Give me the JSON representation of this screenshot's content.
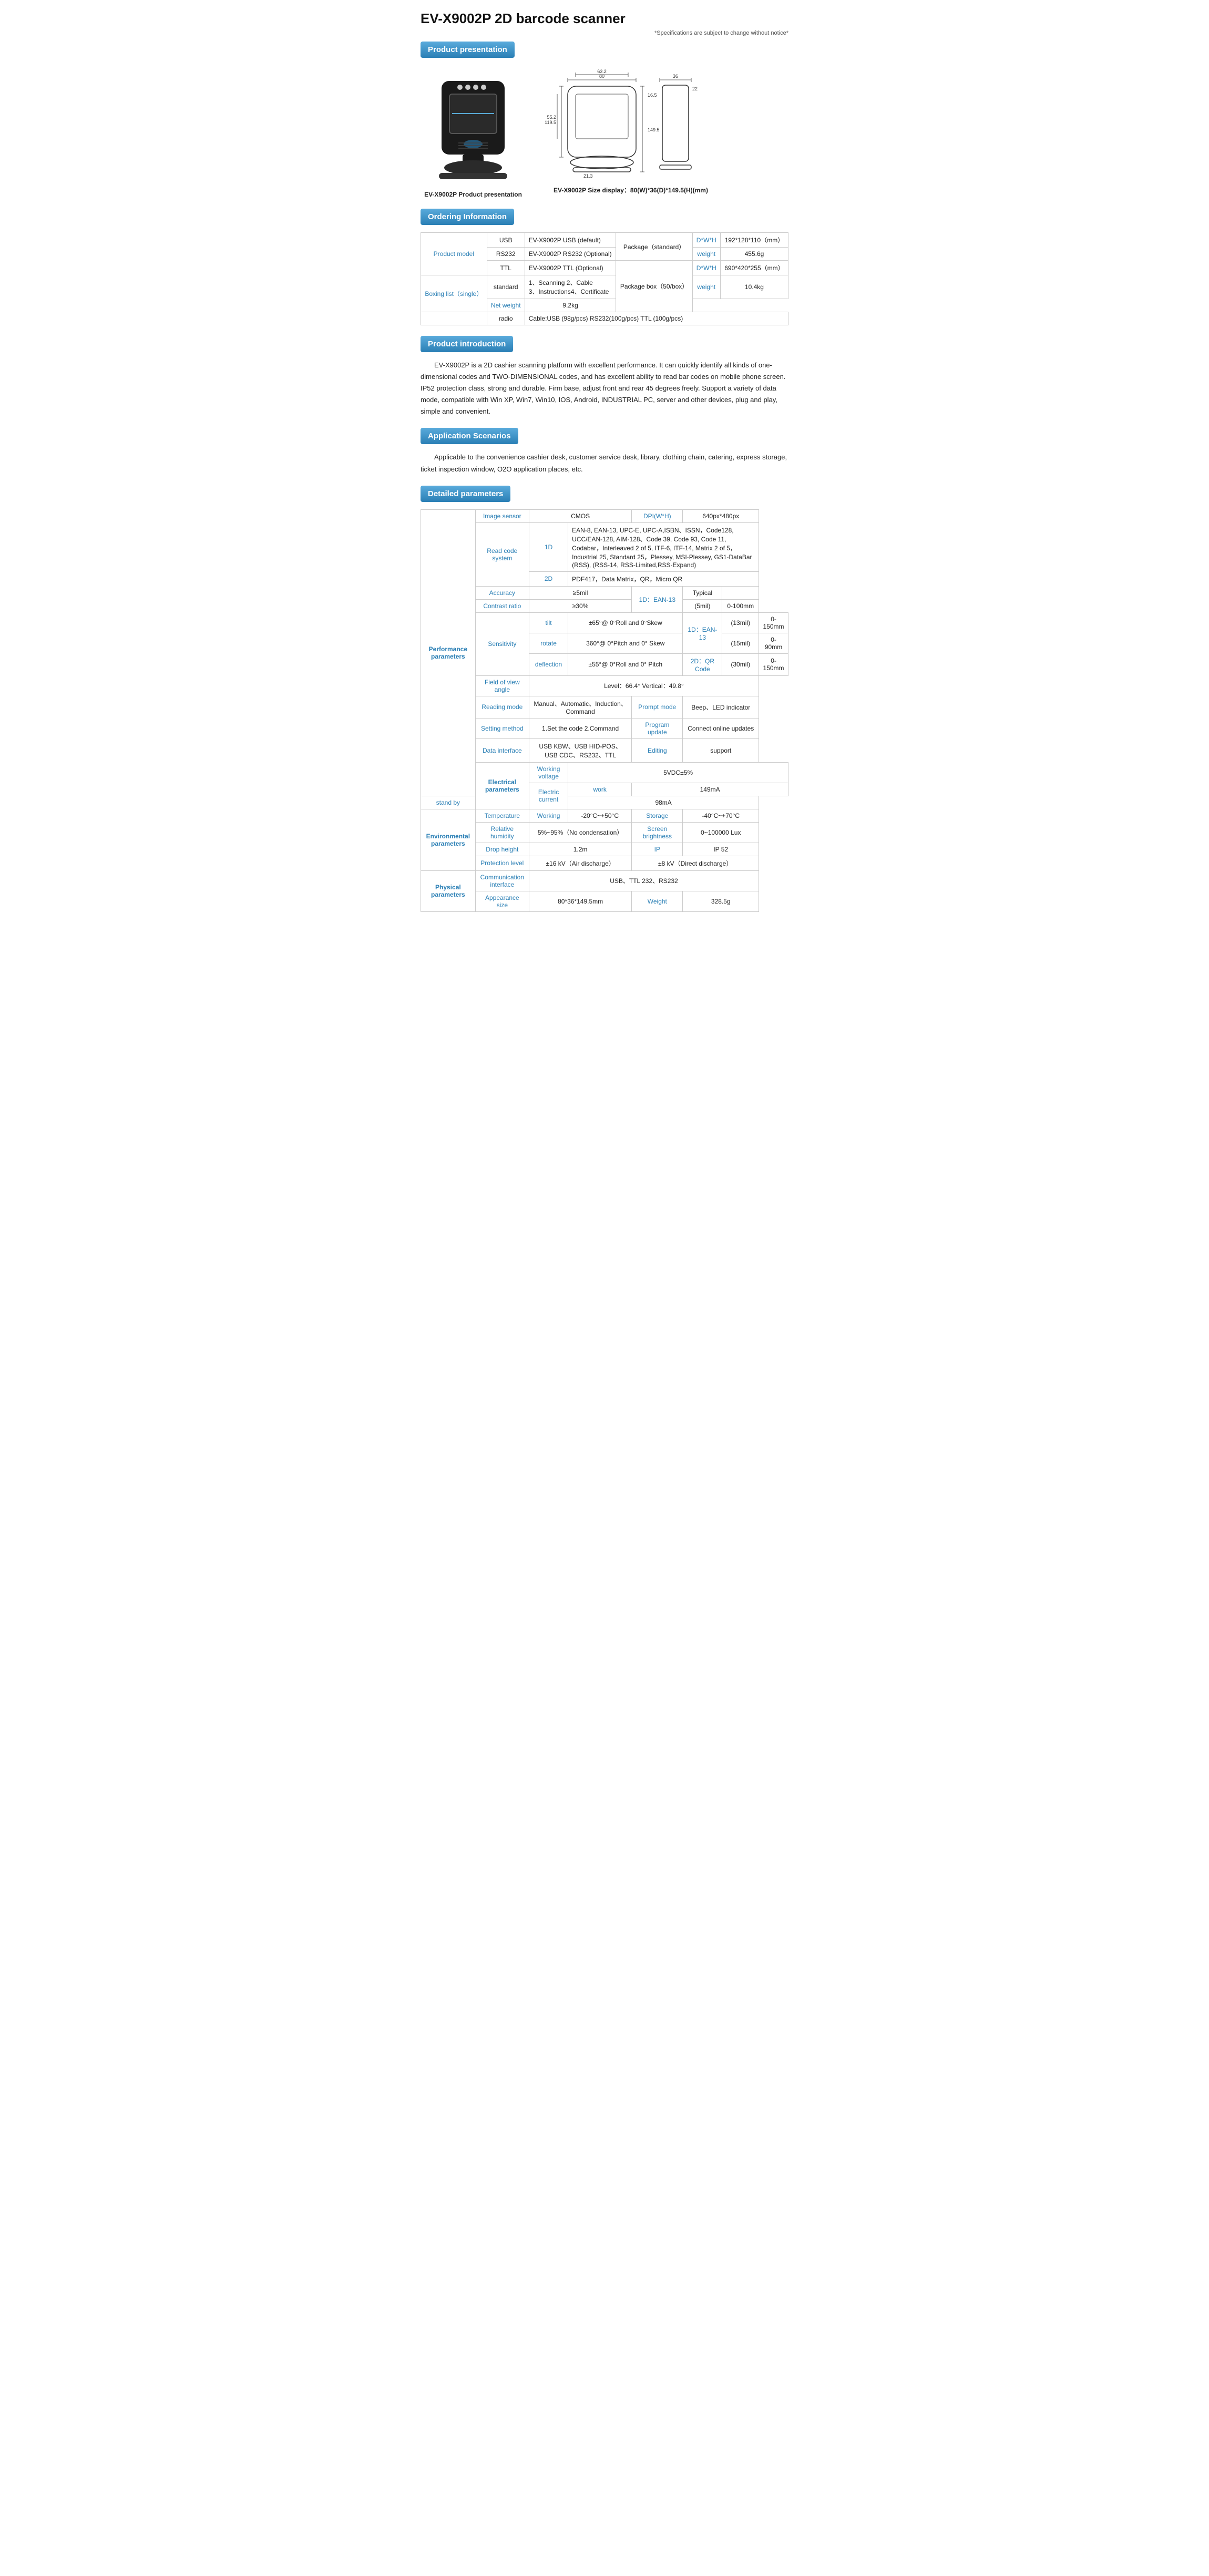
{
  "title": "EV-X9002P  2D barcode scanner",
  "spec_note": "*Specifications are subject to change without notice*",
  "sections": {
    "product_presentation": {
      "label": "Product presentation",
      "scanner_caption": "EV-X9002P Product presentation",
      "size_caption": "EV-X9002P Size display：80(W)*36(D)*149.5(H)(mm)"
    },
    "ordering": {
      "label": "Ordering Information",
      "rows": [
        {
          "group": "Product model",
          "interface": "USB",
          "model": "EV-X9002P USB (default)"
        },
        {
          "group": "",
          "interface": "RS232",
          "model": "EV-X9002P RS232 (Optional)"
        },
        {
          "group": "",
          "interface": "TTL",
          "model": "EV-X9002P TTL (Optional)"
        }
      ],
      "boxing": {
        "group": "Boxing list（single）",
        "standard_label": "standard",
        "standard_items": "1、Scanning  2、Cable\n3、Instructions4、Certificate",
        "radio_label": "radio",
        "radio_items": "Cable:USB (98g/pcs)    RS232(100g/pcs)    TTL (100g/pcs)"
      },
      "package": {
        "standard_label": "Package（standard）",
        "dwh_label": "D*W*H",
        "dwh_value": "192*128*110（mm）",
        "weight_label": "weight",
        "weight_value": "455.6g",
        "box_label": "Package box（50/box）",
        "box_dwh_label": "D*W*H",
        "box_dwh_value": "690*420*255（mm）",
        "box_weight_label": "weight",
        "box_weight_value": "10.4kg",
        "net_weight_label": "Net weight",
        "net_weight_value": "9.2kg"
      }
    },
    "introduction": {
      "label": "Product introduction",
      "text": "EV-X9002P is a 2D cashier scanning platform with excellent performance. It can quickly identify all kinds of one-dimensional codes and TWO-DIMENSIONAL codes, and has excellent ability to read bar codes on mobile phone screen. IP52 protection class, strong and durable. Firm base, adjust front and rear 45 degrees freely. Support a variety of data mode, compatible with Win XP, Win7, Win10, IOS, Android, INDUSTRIAL PC, server and other devices, plug and play, simple and convenient."
    },
    "application": {
      "label": "Application Scenarios",
      "text": "Applicable to the convenience cashier desk, customer service desk, library, clothing chain, catering, express storage, ticket inspection window, O2O application places, etc."
    },
    "detailed": {
      "label": "Detailed parameters",
      "groups": [
        {
          "group": "Performance parameters",
          "params": [
            {
              "name": "Image sensor",
              "values": [
                [
                  "CMOS",
                  ""
                ],
                [
                  "DPI(W*H)",
                  "640px*480px"
                ]
              ]
            },
            {
              "name": "Read code system",
              "sub": "1D",
              "values_long": "EAN-8, EAN-13, UPC-E, UPC-A,ISBN、ISSN，Code128, UCC/EAN-128, AIM-128、Code 39, Code 93, Code 11, Codabar，Interleaved 2 of 5, ITF-6, ITF-14, Matrix 2 of 5，Industrial 25, Standard 25，Plessey, MSI-Plessey, GS1-DataBar (RSS), (RSS-14, RSS-Limited,RSS-Expand)"
            },
            {
              "name": "",
              "sub": "2D",
              "values_long": "PDF417，Data Matrix，QR，Micro QR"
            },
            {
              "name": "Accuracy",
              "value": "≥5mil"
            },
            {
              "name": "Contrast ratio",
              "value": "≥30%"
            },
            {
              "name": "Sensitivity",
              "sub_rows": [
                {
                  "sub": "tilt",
                  "value": "±65°@ 0°Roll and 0°Skew"
                },
                {
                  "sub": "rotate",
                  "value": "360°@ 0°Pitch and 0° Skew"
                },
                {
                  "sub": "deflection",
                  "value": "±55°@ 0°Roll and 0° Pitch"
                }
              ]
            },
            {
              "name": "Field of view angle",
              "value": "Level：66.4°    Vertical：49.8°"
            },
            {
              "name": "Reading mode",
              "value": "Manual、Automatic、Induction、Command",
              "extra_name": "Prompt mode",
              "extra_value": "Beep、LED indicator"
            },
            {
              "name": "Setting method",
              "value": "1.Set the code   2.Command",
              "extra_name": "Program update",
              "extra_value": "Connect online updates"
            },
            {
              "name": "Data interface",
              "value": "USB KBW、USB HID-POS、USB CDC、RS232、TTL",
              "extra_name": "Editing",
              "extra_value": "support"
            }
          ],
          "sensitivity_right": {
            "1d_label": "1D：EAN-13",
            "2d_label": "2D：QR Code",
            "rows": [
              {
                "label": "Typical",
                "value": ""
              },
              {
                "label": "(5mil)",
                "value": "0-100mm"
              },
              {
                "label": "(13mil)",
                "value": "0-150mm"
              },
              {
                "label": "(15mil)",
                "value": "0-90mm"
              },
              {
                "label": "(30mil)",
                "value": "0-150mm"
              }
            ]
          }
        },
        {
          "group": "Electrical parameters",
          "params": [
            {
              "name": "Working voltage",
              "value": "5VDC±5%"
            },
            {
              "name": "Electric current",
              "sub_rows": [
                {
                  "sub": "work",
                  "value": "149mA"
                },
                {
                  "sub": "stand by",
                  "value": "98mA"
                }
              ]
            }
          ]
        },
        {
          "group": "Environmental parameters",
          "params": [
            {
              "name": "Temperature",
              "sub": "Working",
              "value": "-20°C~+50°C",
              "extra_name": "Storage",
              "extra_value": "-40°C~+70°C"
            },
            {
              "name": "Relative humidity",
              "value": "5%~95%（No condensation）",
              "extra_name": "Screen brightness",
              "extra_value": "0~100000 Lux"
            },
            {
              "name": "Drop height",
              "value": "1.2m",
              "extra_name": "IP",
              "extra_value": "IP 52"
            },
            {
              "name": "Protection level",
              "value": "±16 kV（Air discharge）",
              "extra_value": "±8 kV（Direct discharge）"
            }
          ]
        },
        {
          "group": "Physical parameters",
          "params": [
            {
              "name": "Communication interface",
              "value": "USB、TTL 232、RS232"
            },
            {
              "name": "Appearance size",
              "value": "80*36*149.5mm",
              "extra_name": "Weight",
              "extra_value": "328.5g"
            }
          ]
        }
      ]
    }
  }
}
